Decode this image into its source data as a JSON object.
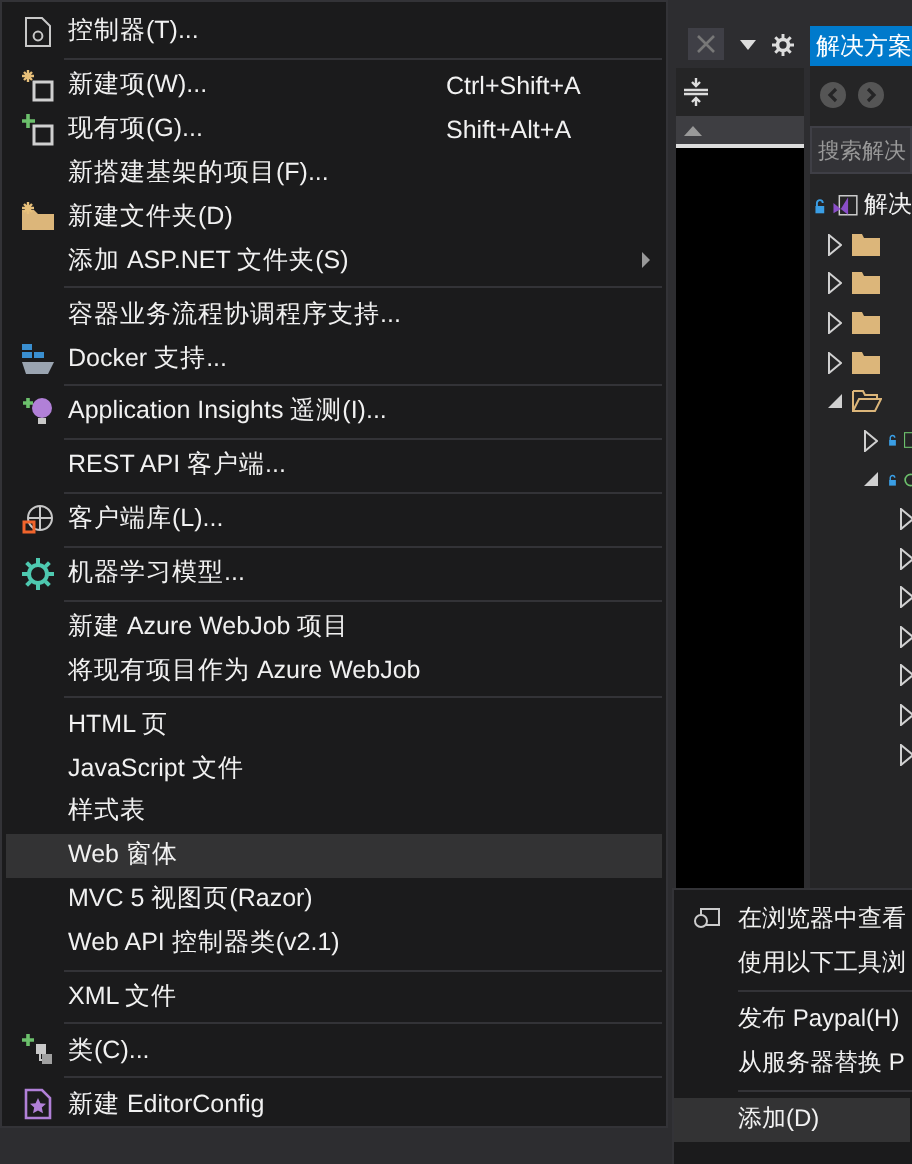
{
  "context_menu": {
    "groups": [
      {
        "items": [
          {
            "label": "控制器(T)...",
            "has_submenu": false,
            "selected": false
          }
        ]
      },
      {
        "items": [
          {
            "label": "新建项(W)...",
            "shortcut": "Ctrl+Shift+A",
            "has_submenu": false,
            "selected": false
          },
          {
            "label": "现有项(G)...",
            "shortcut": "Shift+Alt+A",
            "has_submenu": false,
            "selected": false
          },
          {
            "label": "新搭建基架的项目(F)...",
            "has_submenu": false,
            "selected": false
          },
          {
            "label": "新建文件夹(D)",
            "has_submenu": false,
            "selected": false
          },
          {
            "label": "添加 ASP.NET 文件夹(S)",
            "has_submenu": true,
            "selected": false
          }
        ]
      },
      {
        "items": [
          {
            "label": "容器业务流程协调程序支持...",
            "has_submenu": false,
            "selected": false
          },
          {
            "label": "Docker 支持...",
            "has_submenu": false,
            "selected": false
          }
        ]
      },
      {
        "items": [
          {
            "label": "Application Insights 遥测(I)...",
            "has_submenu": false,
            "selected": false
          }
        ]
      },
      {
        "items": [
          {
            "label": "REST API 客户端...",
            "has_submenu": false,
            "selected": false
          }
        ]
      },
      {
        "items": [
          {
            "label": "客户端库(L)...",
            "has_submenu": false,
            "selected": false
          }
        ]
      },
      {
        "items": [
          {
            "label": "机器学习模型...",
            "has_submenu": false,
            "selected": false
          }
        ]
      },
      {
        "items": [
          {
            "label": "新建 Azure WebJob 项目",
            "has_submenu": false,
            "selected": false
          },
          {
            "label": "将现有项目作为 Azure WebJob",
            "has_submenu": false,
            "selected": false
          }
        ]
      },
      {
        "items": [
          {
            "label": "HTML 页",
            "has_submenu": false,
            "selected": false
          },
          {
            "label": "JavaScript 文件",
            "has_submenu": false,
            "selected": false
          },
          {
            "label": "样式表",
            "has_submenu": false,
            "selected": false
          },
          {
            "label": "Web 窗体",
            "has_submenu": false,
            "selected": true
          },
          {
            "label": "MVC 5 视图页(Razor)",
            "has_submenu": false,
            "selected": false
          },
          {
            "label": "Web API 控制器类(v2.1)",
            "has_submenu": false,
            "selected": false
          }
        ]
      },
      {
        "items": [
          {
            "label": "XML 文件",
            "has_submenu": false,
            "selected": false
          }
        ]
      },
      {
        "items": [
          {
            "label": "类(C)...",
            "has_submenu": false,
            "selected": false
          }
        ]
      },
      {
        "items": [
          {
            "label": "新建 EditorConfig",
            "has_submenu": false,
            "selected": false
          }
        ]
      }
    ]
  },
  "solution_explorer": {
    "title": "解决方案",
    "search": {
      "placeholder": "搜索解决"
    },
    "tree": [
      {
        "kind": "solution",
        "label": "解决",
        "children": [
          {
            "kind": "folder",
            "expanded": false
          },
          {
            "kind": "folder",
            "expanded": false
          },
          {
            "kind": "folder",
            "expanded": false
          },
          {
            "kind": "folder",
            "expanded": false
          },
          {
            "kind": "open_folder",
            "expanded": true,
            "children": [
              {
                "kind": "project",
                "expanded": false
              },
              {
                "kind": "web_project",
                "expanded": true,
                "children": [
                  {
                    "expanded": false
                  },
                  {
                    "expanded": false
                  },
                  {
                    "expanded": false
                  },
                  {
                    "expanded": false
                  },
                  {
                    "expanded": false
                  },
                  {
                    "expanded": false
                  },
                  {
                    "expanded": false
                  }
                ]
              }
            ]
          }
        ]
      }
    ]
  },
  "parent_menu": {
    "groups": [
      {
        "items": [
          {
            "label": "在浏览器中查看",
            "selected": false
          },
          {
            "label": "使用以下工具浏",
            "selected": false
          }
        ]
      },
      {
        "items": [
          {
            "label": "发布 Paypal(H)",
            "selected": false
          },
          {
            "label": "从服务器替换 P",
            "selected": false
          }
        ]
      },
      {
        "items": [
          {
            "label": "添加(D)",
            "selected": true
          }
        ]
      }
    ]
  }
}
